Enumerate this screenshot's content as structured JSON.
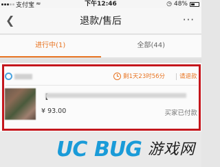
{
  "status_bar": {
    "carrier": "支付宝",
    "time": "下午12:46",
    "battery": "48%"
  },
  "nav": {
    "back_icon": "chevron-left-icon",
    "title": "退款/售后",
    "more_icon": "more-icon",
    "more_glyph": "···"
  },
  "tabs": [
    {
      "label": "进行中(1)",
      "active": true
    },
    {
      "label": "全部(44)",
      "active": false
    }
  ],
  "order": {
    "countdown": "剩1天23时56分",
    "action": "请退款",
    "product_name_prefix": "【",
    "price": "¥ 93.00",
    "status": "买家已付款"
  },
  "watermark": {
    "latin_1": "UC",
    "latin_2": "BUG",
    "chinese": "游戏网",
    "colors": {
      "blue": "#1a9bd8",
      "red": "#e0261e"
    }
  },
  "colors": {
    "accent": "#e87422",
    "highlight_frame": "#c4161c"
  }
}
